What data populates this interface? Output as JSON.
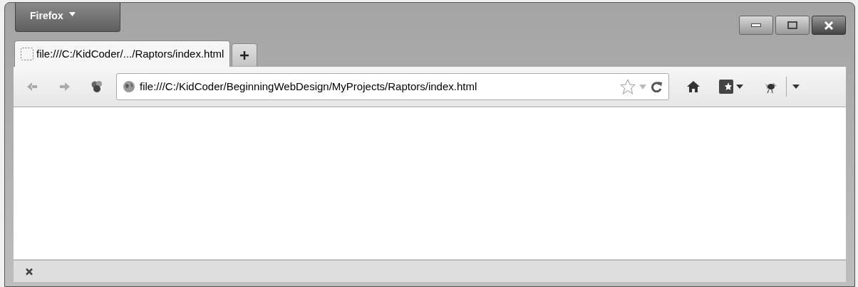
{
  "app_menu": {
    "label": "Firefox"
  },
  "tabs": [
    {
      "label": "file:///C:/KidCoder/.../Raptors/index.html",
      "selected": true
    }
  ],
  "address_bar": {
    "value": "file:///C:/KidCoder/BeginningWebDesign/MyProjects/Raptors/index.html"
  }
}
